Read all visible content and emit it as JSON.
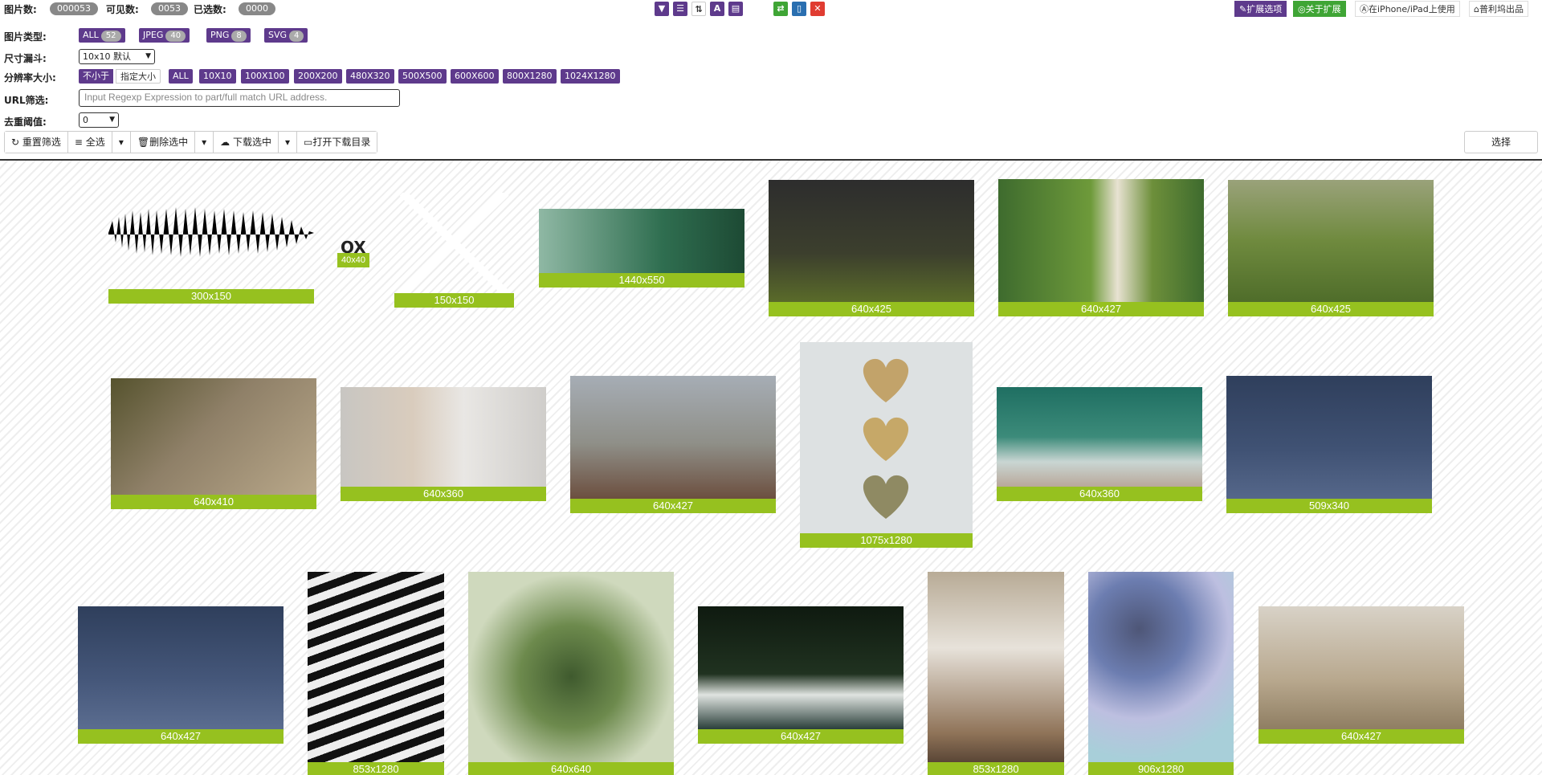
{
  "stats": {
    "total_label": "图片数:",
    "total_value": "000053",
    "visible_label": "可见数:",
    "visible_value": "0053",
    "selected_label": "已选数:",
    "selected_value": "0000"
  },
  "toolbar_icons": [
    "filter-icon",
    "list-icon",
    "sort-icon",
    "font-icon",
    "layout-icon",
    "swap-icon",
    "document-icon",
    "close-icon"
  ],
  "right_buttons": {
    "extension_options": "扩展选项",
    "about_extension": "关于扩展",
    "iphone_ipad": "在iPhone/iPad上使用",
    "publisher": "普利坞出品"
  },
  "filters": {
    "type_label": "图片类型:",
    "types": [
      {
        "label": "ALL",
        "count": "52"
      },
      {
        "label": "JPEG",
        "count": "40"
      },
      {
        "label": "PNG",
        "count": "8"
      },
      {
        "label": "SVG",
        "count": "4"
      }
    ],
    "funnel_label": "尺寸漏斗:",
    "funnel_value": "10x10 默认",
    "resolution_label": "分辨率大小:",
    "mode_not_less": "不小于",
    "mode_specified": "指定大小",
    "resolutions": [
      "ALL",
      "10X10",
      "100X100",
      "200X200",
      "480X320",
      "500X500",
      "600X600",
      "800X1280",
      "1024X1280"
    ],
    "url_label": "URL筛选:",
    "url_placeholder": "Input Regexp Expression to part/full match URL address.",
    "dedup_label": "去重阈值:",
    "dedup_value": "0"
  },
  "actions": {
    "reset": "重置筛选",
    "select_all": "全选",
    "delete_selected": "删除选中",
    "download_selected": "下载选中",
    "open_download_dir": "打开下载目录",
    "choose": "选择"
  },
  "images": [
    {
      "size": "300x150",
      "kind": "waveform"
    },
    {
      "size": "40x40",
      "kind": "ox"
    },
    {
      "size": "150x150",
      "kind": "cross"
    },
    {
      "size": "1440x550",
      "kind": "dandelion"
    },
    {
      "size": "640x425",
      "kind": "grass-dark"
    },
    {
      "size": "640x427",
      "kind": "woman-garden"
    },
    {
      "size": "640x425",
      "kind": "blue-bird"
    },
    {
      "size": "640x410",
      "kind": "pheasant"
    },
    {
      "size": "640x360",
      "kind": "hand-blossom"
    },
    {
      "size": "640x427",
      "kind": "church-town"
    },
    {
      "size": "1075x1280",
      "kind": "hearts"
    },
    {
      "size": "640x360",
      "kind": "ocean-waves"
    },
    {
      "size": "509x340",
      "kind": "egrets"
    },
    {
      "size": "640x427",
      "kind": "egrets-2"
    },
    {
      "size": "853x1280",
      "kind": "zebra"
    },
    {
      "size": "640x640",
      "kind": "leaf-bird"
    },
    {
      "size": "640x427",
      "kind": "swans"
    },
    {
      "size": "853x1280",
      "kind": "sofa-room"
    },
    {
      "size": "906x1280",
      "kind": "clouds-illustration"
    },
    {
      "size": "640x427",
      "kind": "dry-grass"
    }
  ],
  "colors": {
    "accent_purple": "#5e3a8c",
    "caption_green": "#96c11f",
    "about_green": "#3fa535",
    "close_red": "#e03c31"
  }
}
